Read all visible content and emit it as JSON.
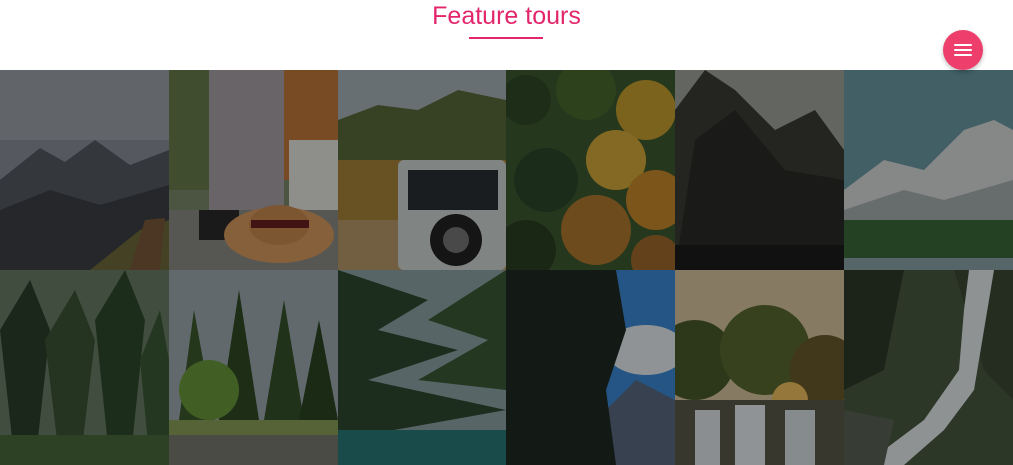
{
  "header": {
    "title": "Feature tours",
    "accent_color": "#e3256b",
    "menu_icon": "hamburger-icon"
  },
  "gallery": {
    "rows": 2,
    "columns": 6,
    "tiles": [
      {
        "subject": "mountain-ridge-with-hiker"
      },
      {
        "subject": "person-with-straw-hat-reading-map"
      },
      {
        "subject": "jeep-in-autumn-hills"
      },
      {
        "subject": "autumn-forest-aerial"
      },
      {
        "subject": "dark-mountain-peak"
      },
      {
        "subject": "snowy-mountains-over-lake"
      },
      {
        "subject": "pine-forest"
      },
      {
        "subject": "pine-trees-and-rocky-shore"
      },
      {
        "subject": "pine-branches-over-lake"
      },
      {
        "subject": "tree-silhouette-and-mountains"
      },
      {
        "subject": "sunset-waterfall"
      },
      {
        "subject": "mountain-waterfall"
      }
    ]
  }
}
